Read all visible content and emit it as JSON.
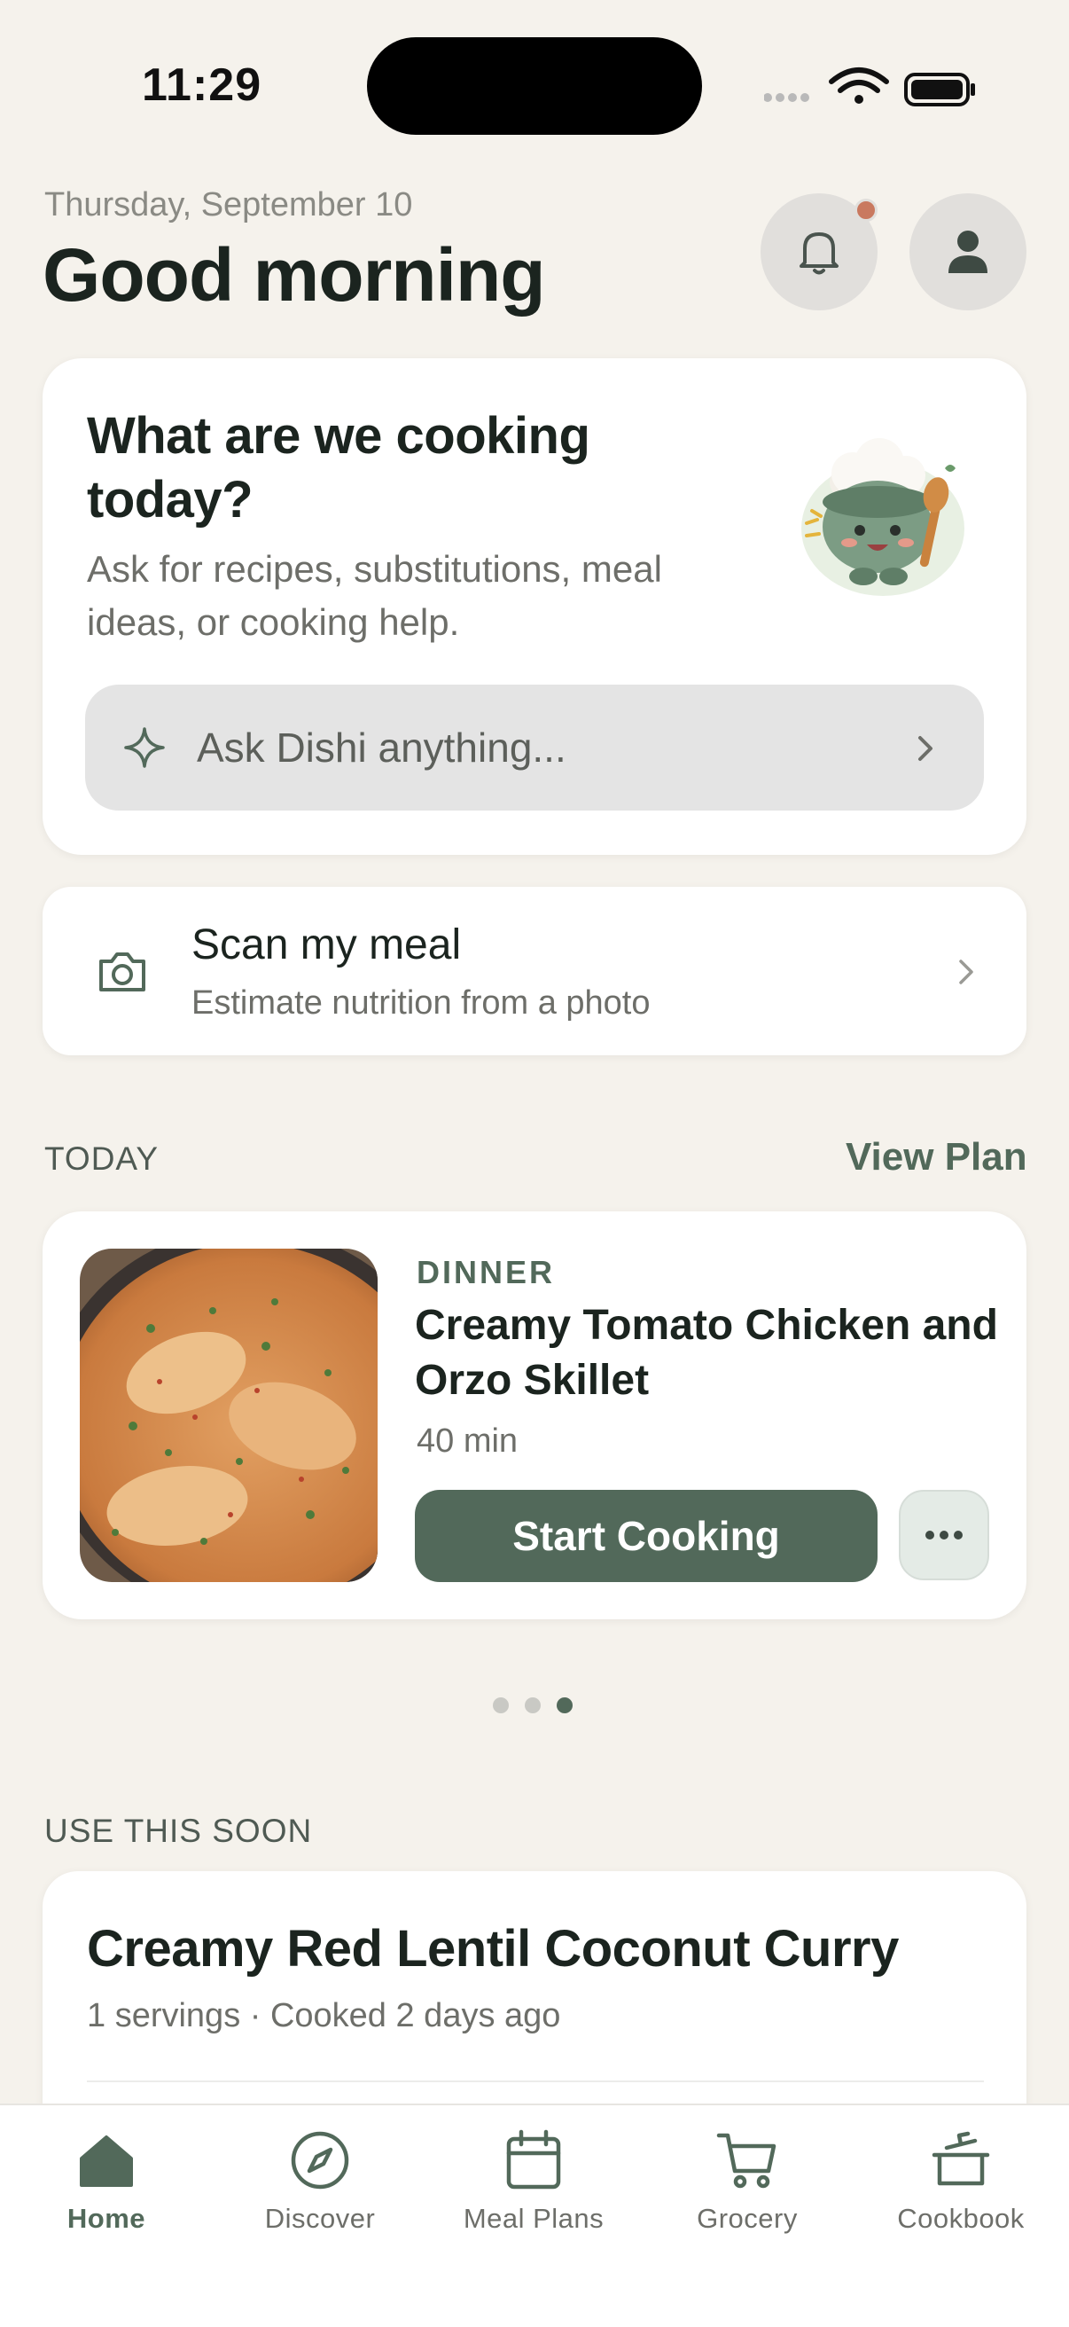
{
  "status_bar": {
    "time": "11:29"
  },
  "header": {
    "date": "Thursday, September 10",
    "greeting": "Good morning",
    "icons": {
      "notifications": "bell-icon",
      "profile": "person-icon"
    }
  },
  "ask_card": {
    "title": "What are we cooking today?",
    "subtitle": "Ask for recipes, substitutions, meal ideas, or cooking help.",
    "input_placeholder": "Ask Dishi anything..."
  },
  "scan_card": {
    "title": "Scan my meal",
    "subtitle": "Estimate nutrition from a photo"
  },
  "today": {
    "section_label": "TODAY",
    "view_plan_label": "View Plan",
    "meal": {
      "type": "DINNER",
      "title": "Creamy Tomato Chicken and Orzo Skillet",
      "time": "40 min",
      "start_label": "Start Cooking"
    },
    "pager": {
      "count": 3,
      "active_index": 2
    }
  },
  "use_soon": {
    "section_label": "USE THIS SOON",
    "recipe": {
      "title": "Creamy Red Lentil Coconut Curry",
      "meta": "1 servings · Cooked 2 days ago"
    }
  },
  "tab_bar": {
    "items": [
      {
        "label": "Home",
        "icon": "home-icon",
        "active": true
      },
      {
        "label": "Discover",
        "icon": "compass-icon",
        "active": false
      },
      {
        "label": "Meal Plans",
        "icon": "calendar-icon",
        "active": false
      },
      {
        "label": "Grocery",
        "icon": "cart-icon",
        "active": false
      },
      {
        "label": "Cookbook",
        "icon": "pot-icon",
        "active": false
      }
    ]
  },
  "colors": {
    "accent": "#52695a",
    "background": "#f5f2ec",
    "notification_dot": "#c9795f"
  }
}
